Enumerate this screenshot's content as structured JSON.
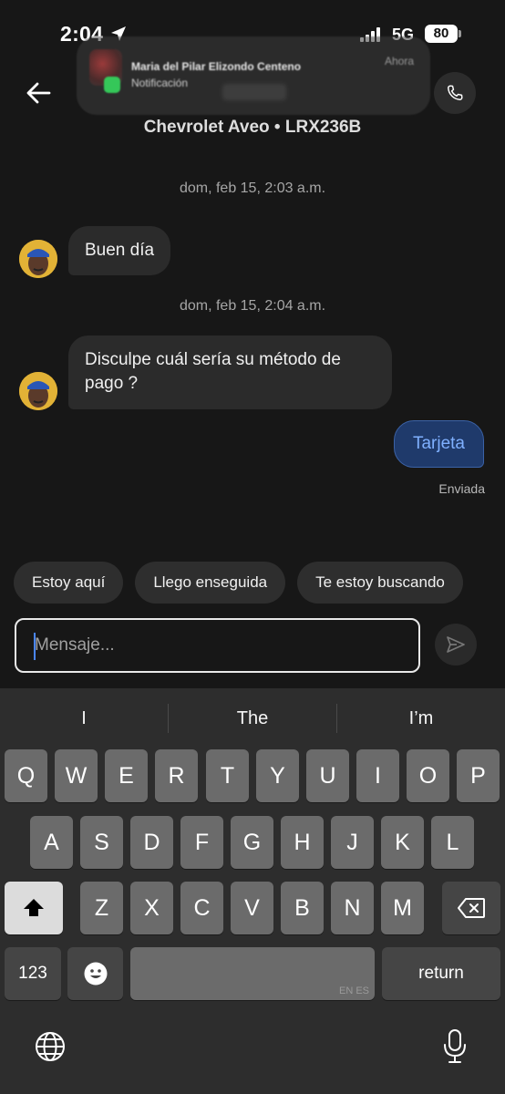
{
  "status_bar": {
    "time": "2:04",
    "network": "5G",
    "battery": "80"
  },
  "notification": {
    "title": "Maria del Pilar Elizondo Centeno",
    "subtitle": "Notificación",
    "time": "Ahora"
  },
  "header": {
    "vehicle": "Chevrolet Aveo • LRX236B"
  },
  "messages": [
    {
      "timestamp": "dom, feb 15, 2:03 a.m.",
      "text": "Buen día",
      "direction": "in"
    },
    {
      "timestamp": "dom, feb 15, 2:04 a.m.",
      "text": "Disculpe cuál sería su método de pago ?",
      "direction": "in"
    },
    {
      "text": "Tarjeta",
      "direction": "out",
      "status": "Enviada"
    }
  ],
  "quick_replies": [
    "Estoy aquí",
    "Llego enseguida",
    "Te estoy buscando"
  ],
  "composer": {
    "placeholder": "Mensaje..."
  },
  "keyboard": {
    "suggestions": [
      "I",
      "The",
      "I’m"
    ],
    "row1": [
      "Q",
      "W",
      "E",
      "R",
      "T",
      "Y",
      "U",
      "I",
      "O",
      "P"
    ],
    "row2": [
      "A",
      "S",
      "D",
      "F",
      "G",
      "H",
      "J",
      "K",
      "L"
    ],
    "row3": [
      "Z",
      "X",
      "C",
      "V",
      "B",
      "N",
      "M"
    ],
    "numbers_label": "123",
    "space_lang": "EN ES",
    "return_label": "return"
  },
  "colors": {
    "background": "#171717",
    "outgoing_bubble": "#1f3a6b",
    "outgoing_text": "#7fb0ff",
    "incoming_bubble": "#2b2b2b"
  }
}
